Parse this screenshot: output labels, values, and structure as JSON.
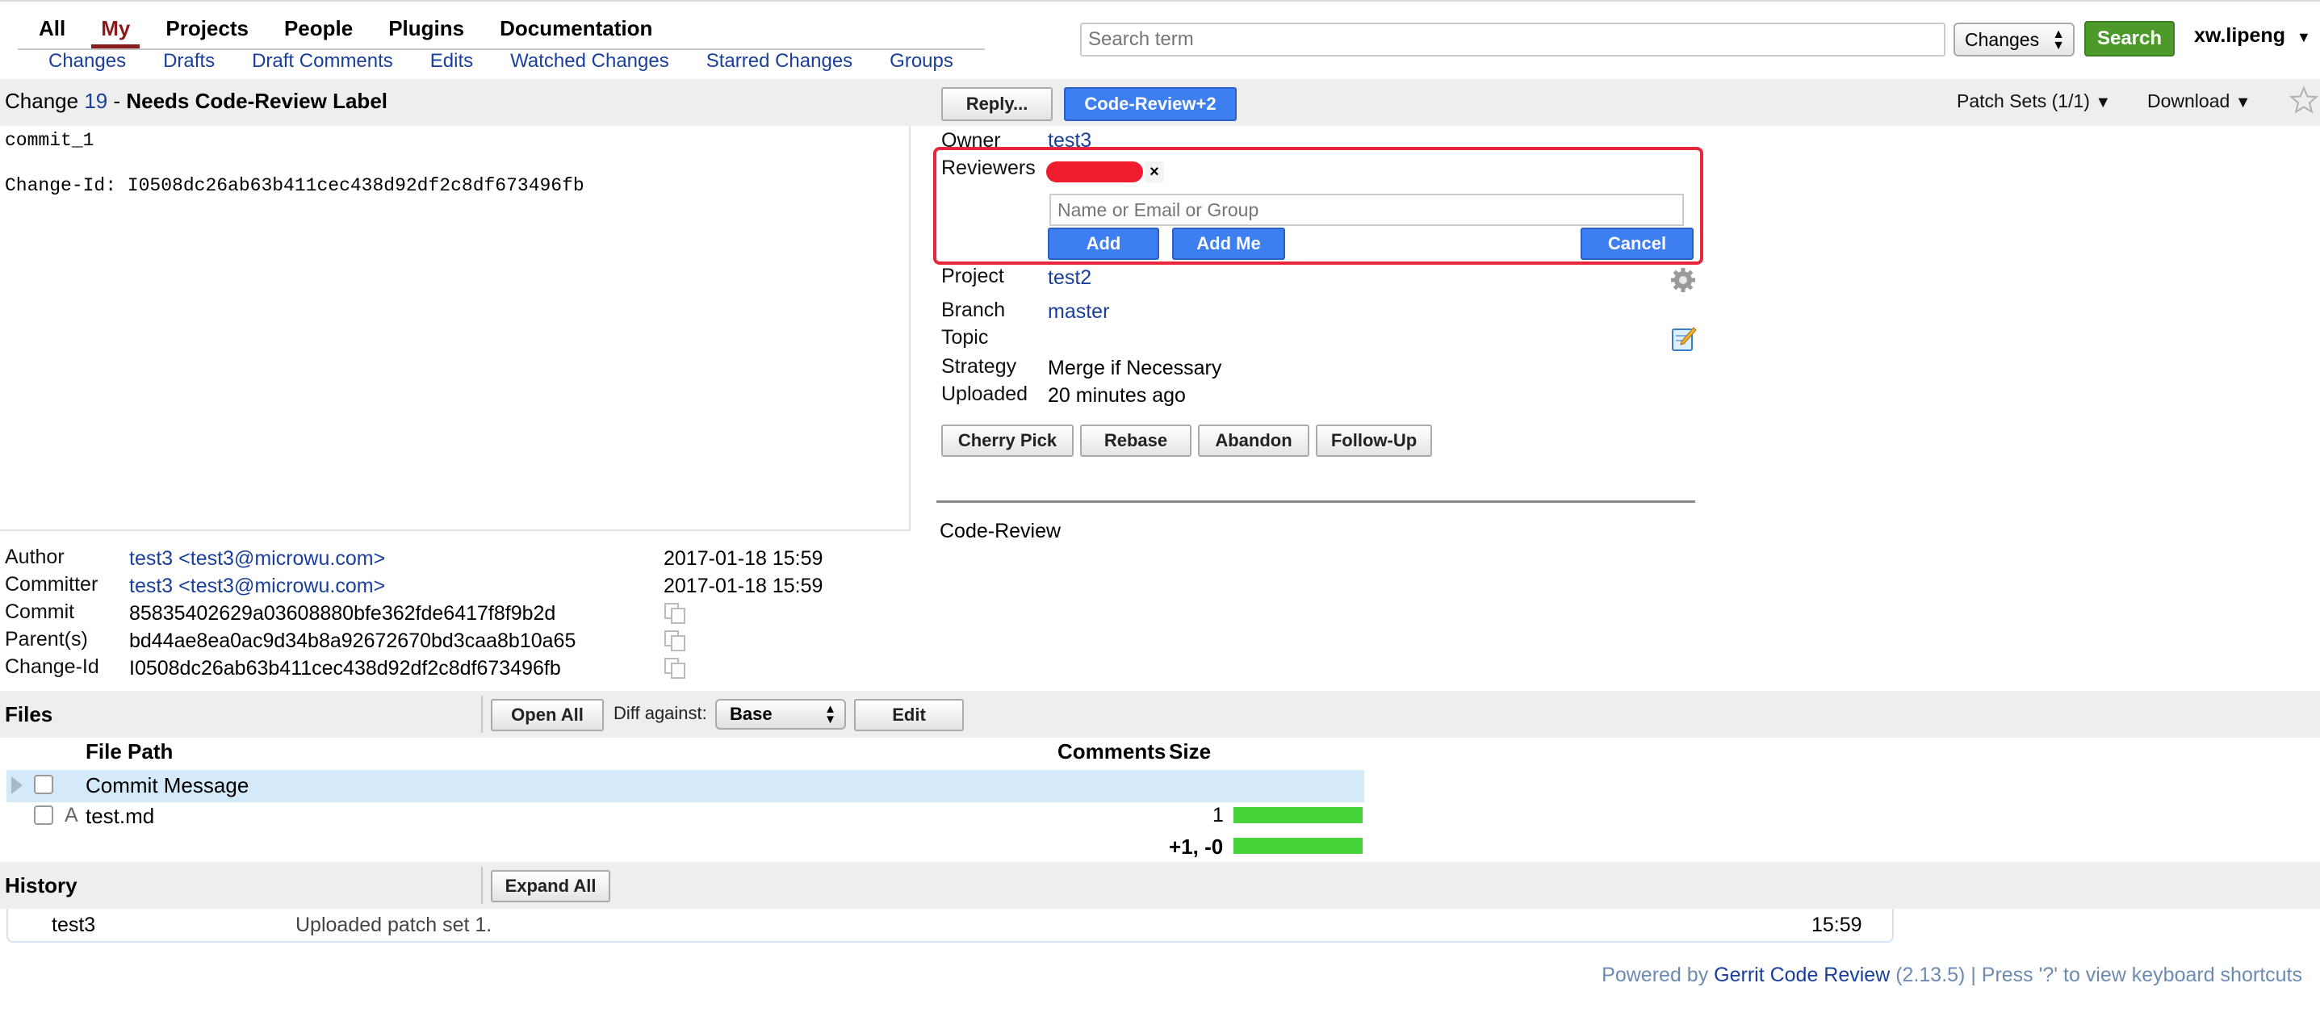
{
  "nav": {
    "top": [
      "All",
      "My",
      "Projects",
      "People",
      "Plugins",
      "Documentation"
    ],
    "active": "My",
    "sub": [
      "Changes",
      "Drafts",
      "Draft Comments",
      "Edits",
      "Watched Changes",
      "Starred Changes",
      "Groups"
    ]
  },
  "search": {
    "placeholder": "Search term",
    "scope": "Changes",
    "button": "Search"
  },
  "user": "xw.lipeng",
  "change": {
    "prefix": "Change",
    "number": "19",
    "dash": " - ",
    "status": "Needs Code-Review Label",
    "reply_button": "Reply...",
    "vote_button": "Code-Review+2",
    "patch_sets": "Patch Sets (1/1)",
    "download": "Download"
  },
  "commit_message": "commit_1\n\nChange-Id: I0508dc26ab63b411cec438d92df2c8df673496fb",
  "info": {
    "owner_label": "Owner",
    "owner": "test3",
    "reviewers_label": "Reviewers",
    "reviewer_input_placeholder": "Name or Email or Group",
    "add": "Add",
    "add_me": "Add Me",
    "cancel": "Cancel",
    "project_label": "Project",
    "project": "test2",
    "branch_label": "Branch",
    "branch": "master",
    "topic_label": "Topic",
    "strategy_label": "Strategy",
    "strategy": "Merge if Necessary",
    "uploaded_label": "Uploaded",
    "uploaded": "20 minutes ago",
    "actions": [
      "Cherry Pick",
      "Rebase",
      "Abandon",
      "Follow-Up"
    ],
    "label_section": "Code-Review"
  },
  "commit_info": {
    "author_label": "Author",
    "author": "test3 <test3@microwu.com>",
    "author_date": "2017-01-18 15:59",
    "committer_label": "Committer",
    "committer": "test3 <test3@microwu.com>",
    "committer_date": "2017-01-18 15:59",
    "commit_label": "Commit",
    "commit": "85835402629a03608880bfe362fde6417f8f9b2d",
    "parent_label": "Parent(s)",
    "parent": "bd44ae8ea0ac9d34b8a92672670bd3caa8b10a65",
    "changeid_label": "Change-Id",
    "changeid": "I0508dc26ab63b411cec438d92df2c8df673496fb"
  },
  "files": {
    "title": "Files",
    "open_all": "Open All",
    "diff_against_label": "Diff against:",
    "diff_against": "Base",
    "edit": "Edit",
    "col_path": "File Path",
    "col_comments": "Comments",
    "col_size": "Size",
    "rows": [
      {
        "status": "",
        "path": "Commit Message",
        "size": ""
      },
      {
        "status": "A",
        "path": "test.md",
        "size": "1"
      }
    ],
    "total": "+1, -0"
  },
  "history": {
    "title": "History",
    "expand_all": "Expand All",
    "entries": [
      {
        "author": "test3",
        "message": "Uploaded patch set 1.",
        "time": "15:59"
      }
    ]
  },
  "footer": {
    "powered": "Powered by ",
    "gerrit": "Gerrit Code Review",
    "rest": " (2.13.5) | Press '?' to view keyboard shortcuts"
  }
}
